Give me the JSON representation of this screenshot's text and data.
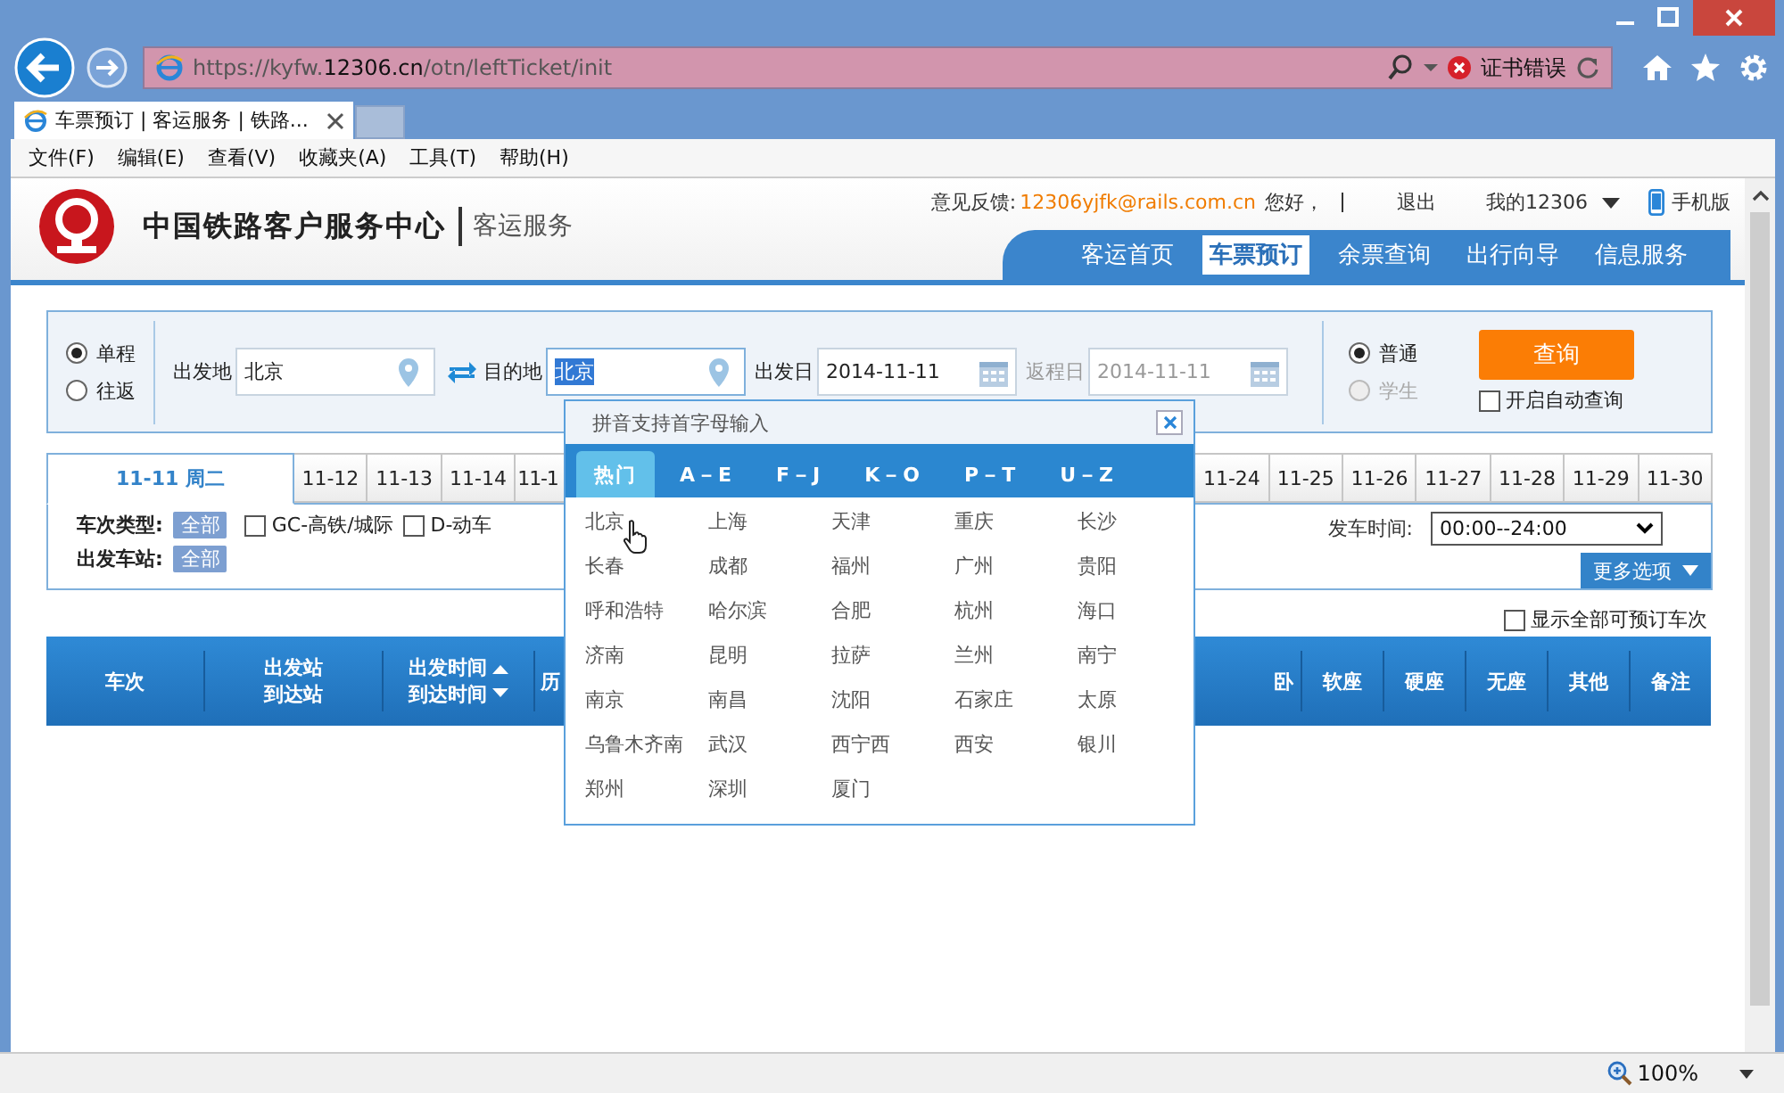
{
  "browser": {
    "address_host": "https://kyfw.",
    "address_domain": "12306.cn",
    "address_path": "/otn/leftTicket/init",
    "cert_error": "证书错误",
    "tab_title": "车票预订 | 客运服务 | 铁路...",
    "menu": [
      "文件(F)",
      "编辑(E)",
      "查看(V)",
      "收藏夹(A)",
      "工具(T)",
      "帮助(H)"
    ]
  },
  "header": {
    "logo_title": "中国铁路客户服务中心",
    "logo_sub": "客运服务",
    "feedback_label": "意见反馈:",
    "feedback_email": "12306yjfk@rails.com.cn",
    "greeting": "您好，",
    "logout": "退出",
    "my_account": "我的12306",
    "mobile": "手机版",
    "nav": [
      {
        "label": "客运首页",
        "selected": false
      },
      {
        "label": "车票预订",
        "selected": true
      },
      {
        "label": "余票查询",
        "selected": false
      },
      {
        "label": "出行向导",
        "selected": false
      },
      {
        "label": "信息服务",
        "selected": false
      }
    ]
  },
  "search": {
    "trip_types": [
      {
        "label": "单程",
        "selected": true
      },
      {
        "label": "往返",
        "selected": false
      }
    ],
    "from_label": "出发地",
    "from_value": "北京",
    "to_label": "目的地",
    "to_value": "北京",
    "date_label": "出发日",
    "date_value": "2014-11-11",
    "return_label": "返程日",
    "return_value": "2014-11-11",
    "passenger_types": [
      {
        "label": "普通",
        "selected": true,
        "disabled": false
      },
      {
        "label": "学生",
        "selected": false,
        "disabled": true
      }
    ],
    "query_button": "查询",
    "auto_query": {
      "label": "开启自动查询",
      "checked": false
    }
  },
  "date_tabs": [
    {
      "label": "11-11 周二",
      "selected": true
    },
    {
      "label": "11-12",
      "selected": false
    },
    {
      "label": "11-13",
      "selected": false
    },
    {
      "label": "11-14",
      "selected": false
    },
    {
      "label": "11-1",
      "selected": false
    },
    {
      "label": "11-24",
      "selected": false
    },
    {
      "label": "11-25",
      "selected": false
    },
    {
      "label": "11-26",
      "selected": false
    },
    {
      "label": "11-27",
      "selected": false
    },
    {
      "label": "11-28",
      "selected": false
    },
    {
      "label": "11-29",
      "selected": false
    },
    {
      "label": "11-30",
      "selected": false
    }
  ],
  "filters": {
    "train_type_label": "车次类型:",
    "train_type_all": "全部",
    "options": [
      {
        "label": "GC-高铁/城际",
        "checked": false
      },
      {
        "label": "D-动车",
        "checked": false
      }
    ],
    "station_label": "出发车站:",
    "station_all": "全部",
    "depart_time_label": "发车时间:",
    "depart_time_value": "00:00--24:00",
    "more_options": "更多选项",
    "show_all": {
      "label": "显示全部可预订车次",
      "checked": false
    }
  },
  "table": {
    "columns": [
      {
        "lines": [
          "车次"
        ]
      },
      {
        "lines": [
          "出发站",
          "到达站"
        ]
      },
      {
        "lines": [
          "出发时间",
          "到达时间"
        ],
        "sortable": true
      },
      {
        "lines": [
          "历"
        ]
      },
      {
        "lines": [
          "卧"
        ]
      },
      {
        "lines": [
          "软座"
        ]
      },
      {
        "lines": [
          "硬座"
        ]
      },
      {
        "lines": [
          "无座"
        ]
      },
      {
        "lines": [
          "其他"
        ]
      },
      {
        "lines": [
          "备注"
        ]
      }
    ]
  },
  "city_popup": {
    "hint": "拼音支持首字母输入",
    "tabs": [
      {
        "label": "热门",
        "selected": true
      },
      {
        "label": "A－E",
        "selected": false
      },
      {
        "label": "F－J",
        "selected": false
      },
      {
        "label": "K－O",
        "selected": false
      },
      {
        "label": "P－T",
        "selected": false
      },
      {
        "label": "U－Z",
        "selected": false
      }
    ],
    "cities": [
      "北京",
      "上海",
      "天津",
      "重庆",
      "长沙",
      "长春",
      "成都",
      "福州",
      "广州",
      "贵阳",
      "呼和浩特",
      "哈尔滨",
      "合肥",
      "杭州",
      "海口",
      "济南",
      "昆明",
      "拉萨",
      "兰州",
      "南宁",
      "南京",
      "南昌",
      "沈阳",
      "石家庄",
      "太原",
      "乌鲁木齐南",
      "武汉",
      "西宁西",
      "西安",
      "银川",
      "郑州",
      "深圳",
      "厦门"
    ]
  },
  "status_bar": {
    "zoom": "100%"
  }
}
